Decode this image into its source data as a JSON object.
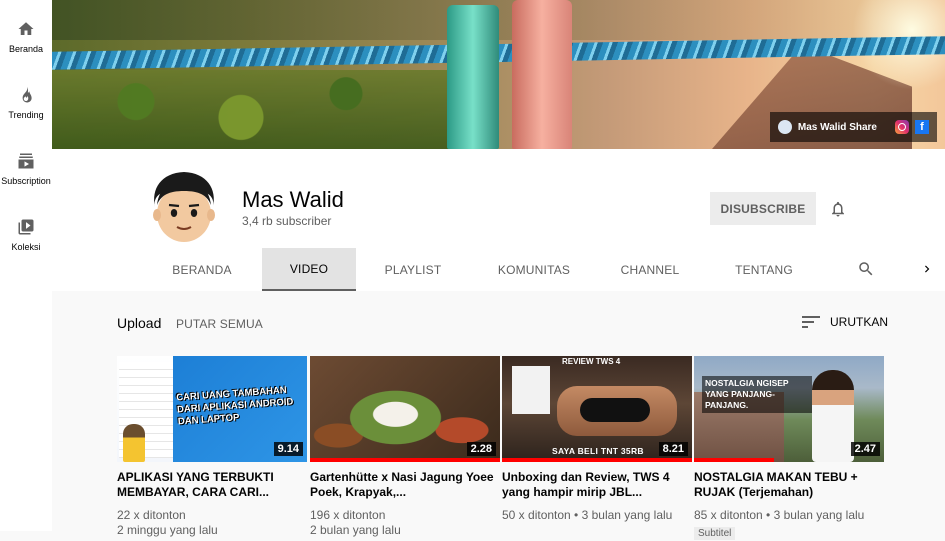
{
  "sidebar": {
    "items": [
      {
        "label": "Beranda",
        "icon": "home-icon"
      },
      {
        "label": "Trending",
        "icon": "fire-icon"
      },
      {
        "label": "Subscription",
        "icon": "subscriptions-icon"
      },
      {
        "label": "Koleksi",
        "icon": "library-icon"
      }
    ]
  },
  "banner": {
    "link_label": "Mas Walid Share",
    "social": [
      "instagram-icon",
      "facebook-icon"
    ],
    "fb_glyph": "f"
  },
  "channel": {
    "name": "Mas Walid",
    "subscribers": "3,4 rb subscriber",
    "unsubscribe_label": "DISUBSCRIBE"
  },
  "tabs": [
    {
      "label": "BERANDA",
      "active": false
    },
    {
      "label": "VIDEO",
      "active": true
    },
    {
      "label": "PLAYLIST",
      "active": false
    },
    {
      "label": "KOMUNITAS",
      "active": false
    },
    {
      "label": "CHANNEL",
      "active": false
    },
    {
      "label": "TENTANG",
      "active": false
    }
  ],
  "uploads": {
    "heading": "Upload",
    "play_all": "PUTAR SEMUA",
    "sort_label": "URUTKAN"
  },
  "videos": [
    {
      "title": "APLIKASI YANG TERBUKTI MEMBAYAR, CARA CARI...",
      "views": "22 x ditonton",
      "age": "2 minggu yang lalu",
      "duration": "9.14",
      "thumb_caption": "CARI UANG TAMBAHAN DARI APLIKASI ANDROID DAN LAPTOP",
      "badge": "",
      "watched_fraction": 0
    },
    {
      "title": "Gartenhütte x Nasi Jagung Yoee Poek, Krapyak,...",
      "views": "196 x ditonton",
      "age": "2 bulan yang lalu",
      "duration": "2.28",
      "thumb_caption": "",
      "badge": "",
      "watched_fraction": 1
    },
    {
      "title": "Unboxing dan Review, TWS 4 yang hampir mirip JBL...",
      "views": "50 x ditonton",
      "age": "3 bulan yang lalu",
      "duration": "8.21",
      "thumb_caption_top": "REVIEW TWS 4",
      "thumb_caption": "SAYA BELI TNT 35RB",
      "badge": "",
      "watched_fraction": 1
    },
    {
      "title": "NOSTALGIA MAKAN TEBU + RUJAK (Terjemahan)",
      "views": "85 x ditonton",
      "age": "3 bulan yang lalu",
      "duration": "2.47",
      "thumb_caption": "NOSTALGIA NGISEP YANG PANJANG-PANJANG.",
      "badge": "Subtitel",
      "watched_fraction": 0.42
    }
  ],
  "colors": {
    "accent_red": "#ff0000",
    "text_primary": "#030303",
    "text_secondary": "#606060"
  }
}
